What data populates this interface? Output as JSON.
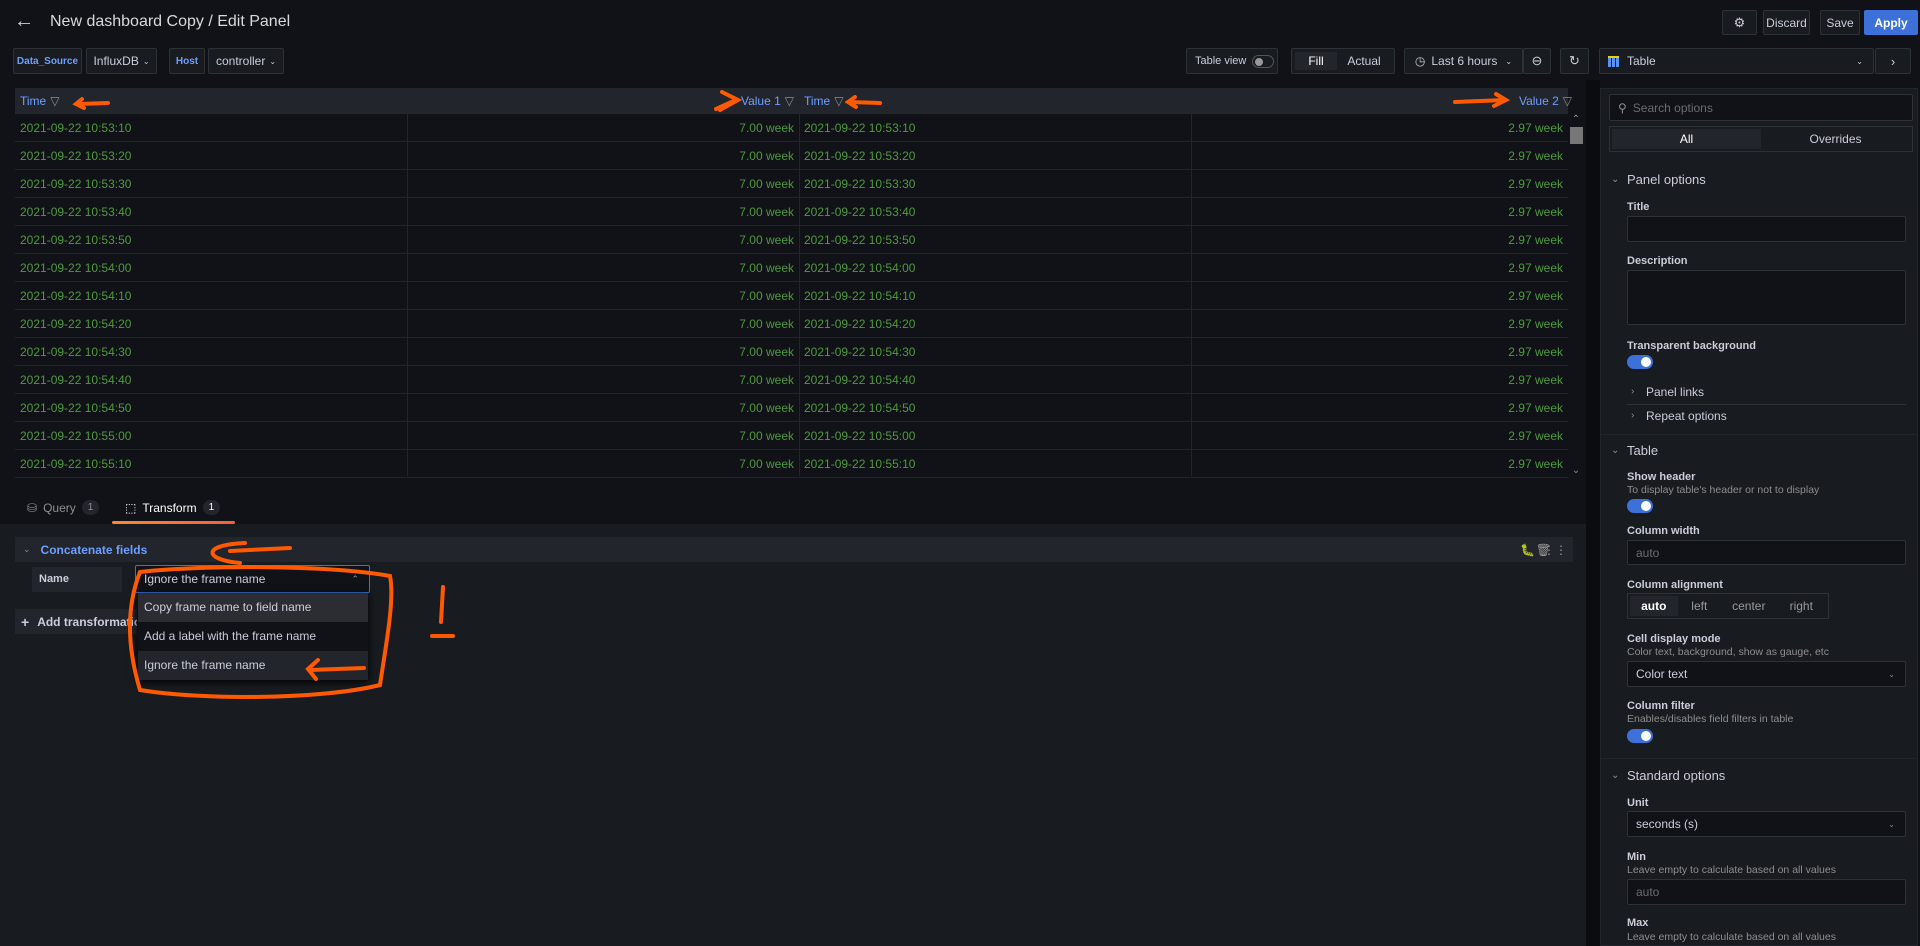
{
  "header": {
    "title": "New dashboard Copy / Edit Panel",
    "discard": "Discard",
    "save": "Save",
    "apply": "Apply"
  },
  "variables": [
    {
      "label": "Data_Source",
      "value": "InfluxDB"
    },
    {
      "label": "Host",
      "value": "controller"
    }
  ],
  "toolbar": {
    "table_view": "Table view",
    "fill": "Fill",
    "actual": "Actual",
    "time_range": "Last 6 hours"
  },
  "viz_picker": {
    "value": "Table"
  },
  "table": {
    "columns": [
      "Time",
      "Value 1",
      "Time",
      "Value 2"
    ],
    "rows": [
      [
        "2021-09-22 10:53:10",
        "7.00 week",
        "2021-09-22 10:53:10",
        "2.97 week"
      ],
      [
        "2021-09-22 10:53:20",
        "7.00 week",
        "2021-09-22 10:53:20",
        "2.97 week"
      ],
      [
        "2021-09-22 10:53:30",
        "7.00 week",
        "2021-09-22 10:53:30",
        "2.97 week"
      ],
      [
        "2021-09-22 10:53:40",
        "7.00 week",
        "2021-09-22 10:53:40",
        "2.97 week"
      ],
      [
        "2021-09-22 10:53:50",
        "7.00 week",
        "2021-09-22 10:53:50",
        "2.97 week"
      ],
      [
        "2021-09-22 10:54:00",
        "7.00 week",
        "2021-09-22 10:54:00",
        "2.97 week"
      ],
      [
        "2021-09-22 10:54:10",
        "7.00 week",
        "2021-09-22 10:54:10",
        "2.97 week"
      ],
      [
        "2021-09-22 10:54:20",
        "7.00 week",
        "2021-09-22 10:54:20",
        "2.97 week"
      ],
      [
        "2021-09-22 10:54:30",
        "7.00 week",
        "2021-09-22 10:54:30",
        "2.97 week"
      ],
      [
        "2021-09-22 10:54:40",
        "7.00 week",
        "2021-09-22 10:54:40",
        "2.97 week"
      ],
      [
        "2021-09-22 10:54:50",
        "7.00 week",
        "2021-09-22 10:54:50",
        "2.97 week"
      ],
      [
        "2021-09-22 10:55:00",
        "7.00 week",
        "2021-09-22 10:55:00",
        "2.97 week"
      ],
      [
        "2021-09-22 10:55:10",
        "7.00 week",
        "2021-09-22 10:55:10",
        "2.97 week"
      ]
    ]
  },
  "tabs": [
    {
      "label": "Query",
      "count": "1"
    },
    {
      "label": "Transform",
      "count": "1"
    }
  ],
  "transform": {
    "title": "Concatenate fields",
    "name_label": "Name",
    "name_value": "Ignore the frame name",
    "options": [
      "Copy frame name to field name",
      "Add a label with the frame name",
      "Ignore the frame name"
    ],
    "add_label": "Add transformation"
  },
  "options": {
    "search_placeholder": "Search options",
    "tab_all": "All",
    "tab_overrides": "Overrides",
    "panel_options": "Panel options",
    "title_label": "Title",
    "description_label": "Description",
    "transparent_label": "Transparent background",
    "panel_links": "Panel links",
    "repeat_options": "Repeat options",
    "table_section": "Table",
    "show_header": "Show header",
    "show_header_desc": "To display table's header or not to display",
    "column_width": "Column width",
    "column_width_ph": "auto",
    "column_alignment": "Column alignment",
    "alignments": [
      "auto",
      "left",
      "center",
      "right"
    ],
    "cell_display_mode": "Cell display mode",
    "cell_display_desc": "Color text, background, show as gauge, etc",
    "cell_display_value": "Color text",
    "column_filter": "Column filter",
    "column_filter_desc": "Enables/disables field filters in table",
    "standard_options": "Standard options",
    "unit": "Unit",
    "unit_value": "seconds (s)",
    "min": "Min",
    "min_desc": "Leave empty to calculate based on all values",
    "min_ph": "auto",
    "max": "Max",
    "max_desc": "Leave empty to calculate based on all values"
  },
  "colors": {
    "accent": "#3d71d9",
    "cell_text": "#4f9a3e",
    "header_text": "#6e9fff",
    "annotation": "#ff5a00"
  }
}
